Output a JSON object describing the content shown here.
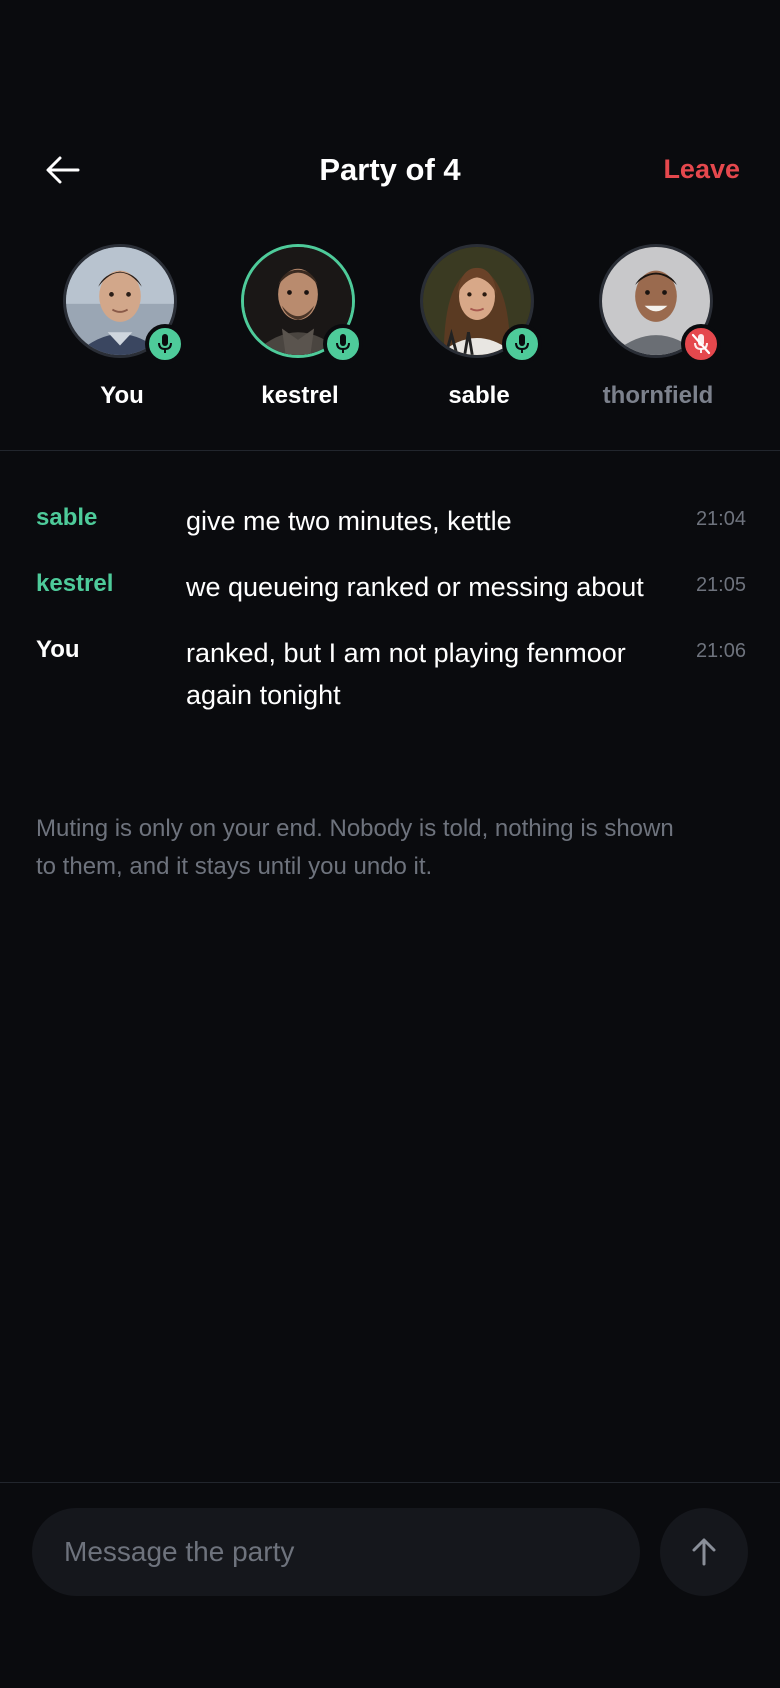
{
  "header": {
    "back_icon": "arrow-left-icon",
    "title": "Party of 4",
    "leave_label": "Leave"
  },
  "colors": {
    "accent": "#4ecb9a",
    "danger": "#e5484d",
    "background": "#0a0b0e",
    "muted_text": "#6e737d"
  },
  "members": [
    {
      "name": "You",
      "mic": "on",
      "mic_icon": "microphone-icon",
      "speaking": false
    },
    {
      "name": "kestrel",
      "mic": "on",
      "mic_icon": "microphone-icon",
      "speaking": true
    },
    {
      "name": "sable",
      "mic": "on",
      "mic_icon": "microphone-icon",
      "speaking": false
    },
    {
      "name": "thornfield",
      "mic": "off",
      "mic_icon": "microphone-muted-icon",
      "speaking": false
    }
  ],
  "messages": [
    {
      "author": "sable",
      "text": "give me two minutes, kettle",
      "time": "21:04"
    },
    {
      "author": "kestrel",
      "text": "we queueing ranked or messing about",
      "time": "21:05"
    },
    {
      "author": "You",
      "text": "ranked, but I am not playing fenmoor again tonight",
      "time": "21:06"
    }
  ],
  "notice": "Muting is only on your end. Nobody is told, nothing is shown to them, and it stays until you undo it.",
  "composer": {
    "placeholder": "Message the party",
    "value": "",
    "send_icon": "arrow-up-icon"
  }
}
